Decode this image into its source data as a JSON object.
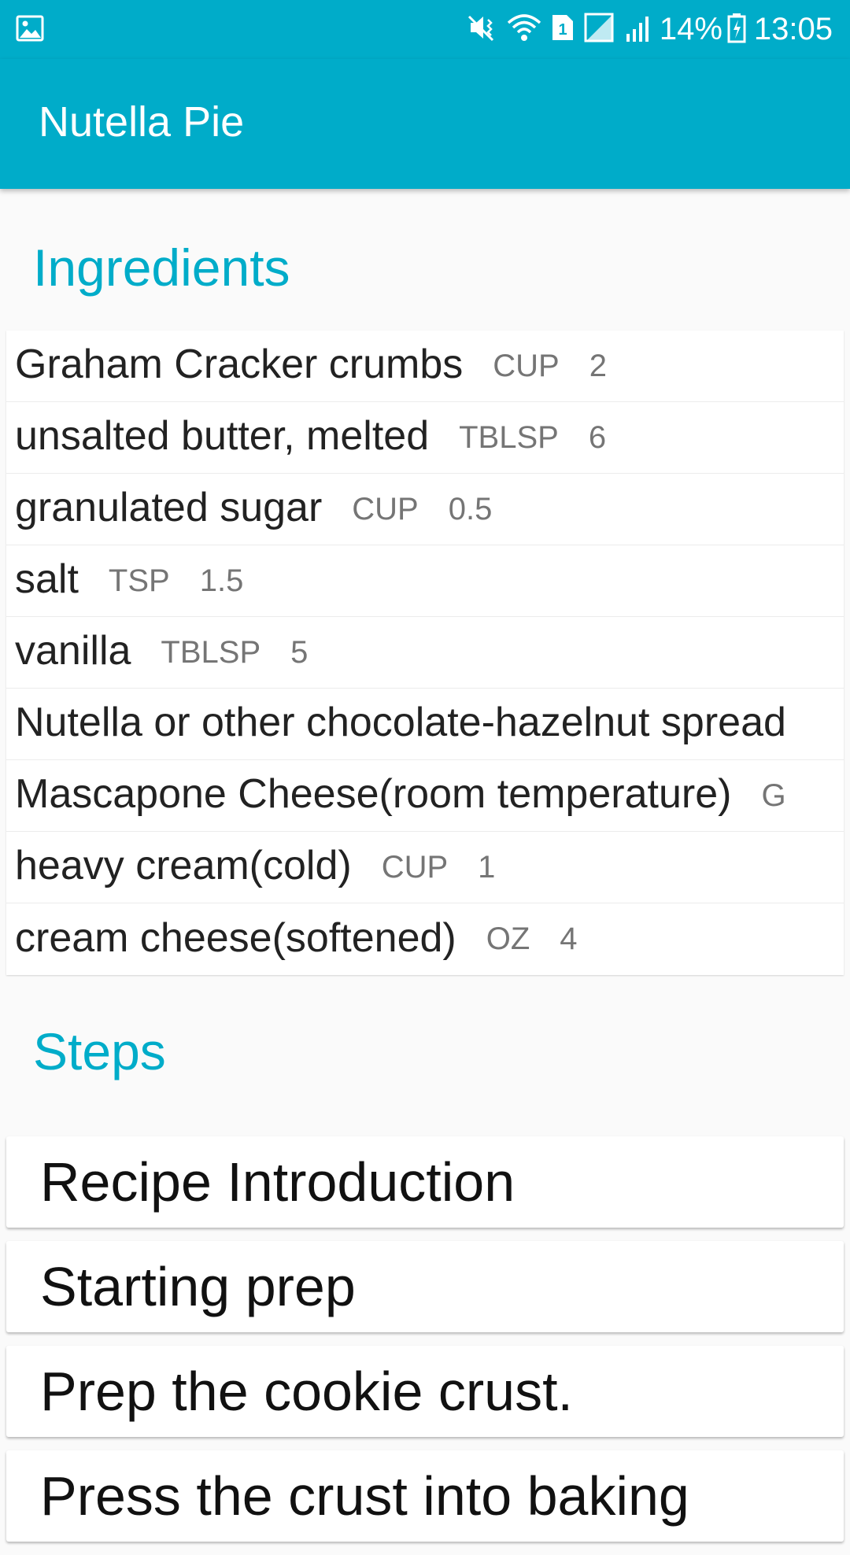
{
  "status_bar": {
    "icons_left": [
      "image-icon"
    ],
    "icons_right": [
      "mute-vibrate-icon",
      "wifi-icon",
      "sim-1-icon",
      "signal-icon",
      "signal-2-icon",
      "battery-icon"
    ],
    "battery": "14%",
    "time": "13:05"
  },
  "app_bar": {
    "title": "Nutella Pie",
    "background_color": "#00acc9"
  },
  "ingredients": {
    "heading": "Ingredients",
    "items": [
      {
        "name": "Graham Cracker crumbs",
        "measure": "CUP",
        "quantity": "2"
      },
      {
        "name": "unsalted butter, melted",
        "measure": "TBLSP",
        "quantity": "6"
      },
      {
        "name": "granulated sugar",
        "measure": "CUP",
        "quantity": "0.5"
      },
      {
        "name": "salt",
        "measure": "TSP",
        "quantity": "1.5"
      },
      {
        "name": "vanilla",
        "measure": "TBLSP",
        "quantity": "5"
      },
      {
        "name": "Nutella or other chocolate-hazelnut spread",
        "measure": "",
        "quantity": ""
      },
      {
        "name": "Mascapone Cheese(room temperature)",
        "measure": "G",
        "quantity": ""
      },
      {
        "name": "heavy cream(cold)",
        "measure": "CUP",
        "quantity": "1"
      },
      {
        "name": "cream cheese(softened)",
        "measure": "OZ",
        "quantity": "4"
      }
    ]
  },
  "steps": {
    "heading": "Steps",
    "items": [
      {
        "label": "Recipe Introduction"
      },
      {
        "label": "Starting prep"
      },
      {
        "label": "Prep the cookie crust."
      },
      {
        "label": "Press the crust into baking"
      }
    ]
  },
  "colors": {
    "accent": "#00acc9",
    "primary_text": "#222222",
    "secondary_text": "#757575",
    "background": "#fafafa"
  }
}
